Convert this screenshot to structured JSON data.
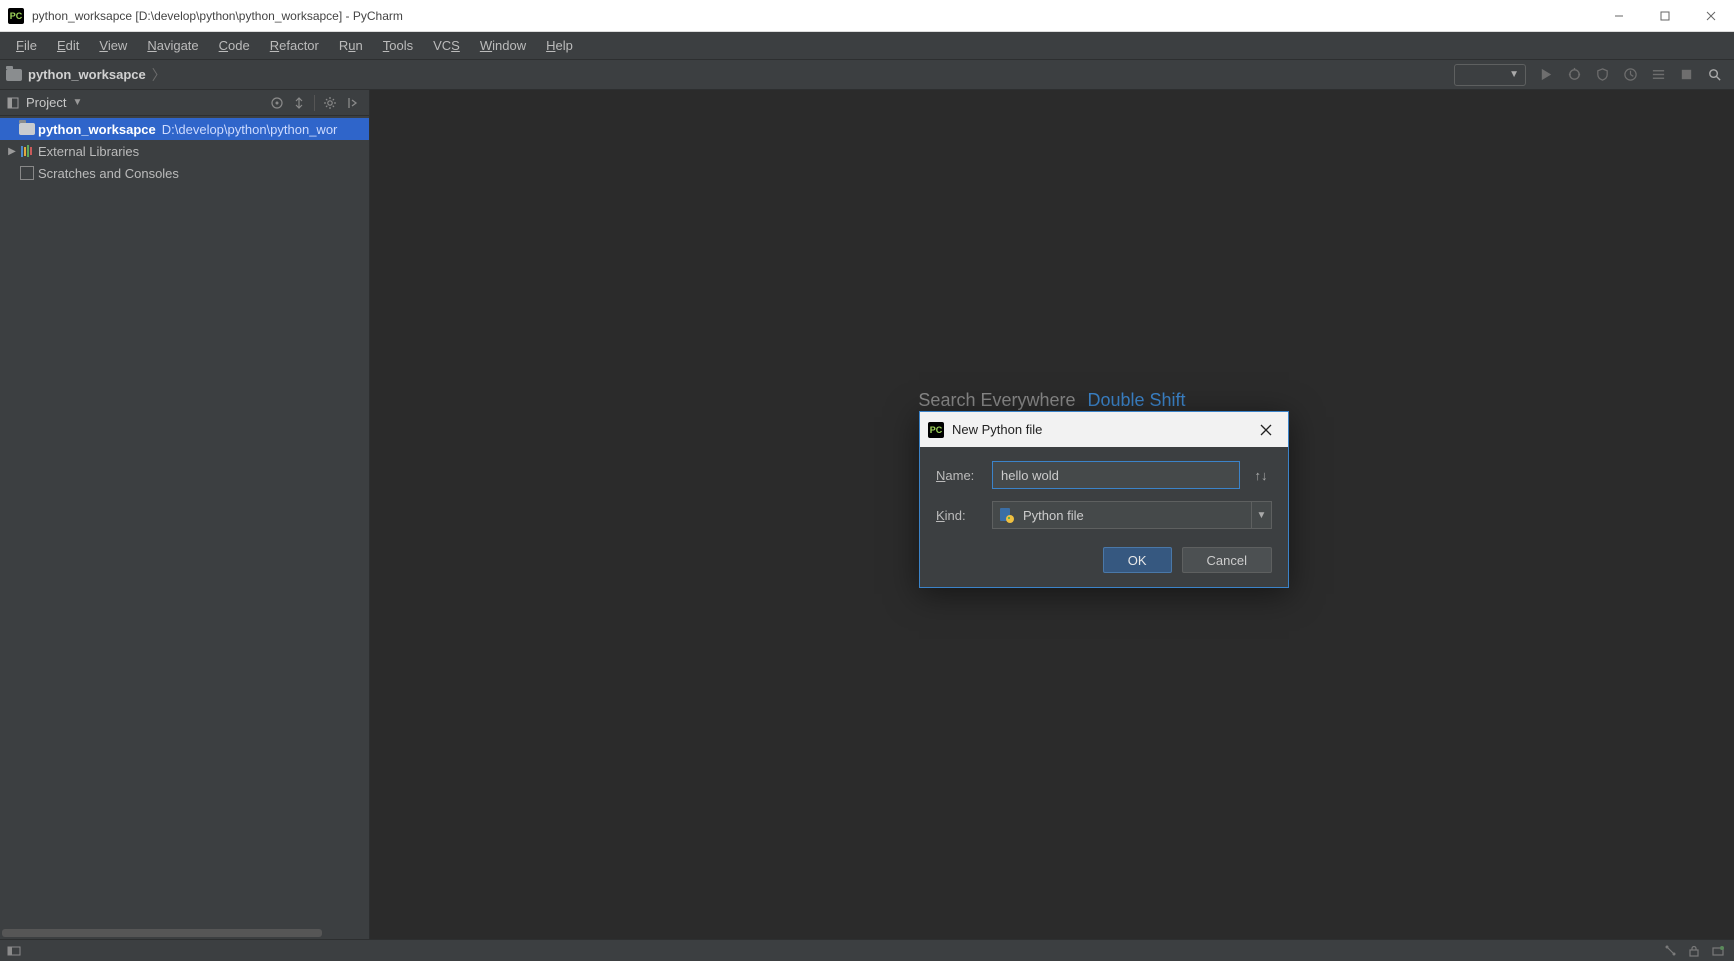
{
  "os_title": "python_worksapce [D:\\develop\\python\\python_worksapce] - PyCharm",
  "menu": [
    "File",
    "Edit",
    "View",
    "Navigate",
    "Code",
    "Refactor",
    "Run",
    "Tools",
    "VCS",
    "Window",
    "Help"
  ],
  "breadcrumb": {
    "label": "python_worksapce"
  },
  "project_panel": {
    "title": "Project"
  },
  "tree": {
    "workspace_name": "python_worksapce",
    "workspace_path": "D:\\develop\\python\\python_wor",
    "external_libs": "External Libraries",
    "scratches": "Scratches and Consoles"
  },
  "welcome": {
    "search_label": "Search Everywhere",
    "search_shortcut": "Double Shift"
  },
  "dialog": {
    "title": "New Python file",
    "name_label": "Name:",
    "name_value": "hello wold",
    "kind_label": "Kind:",
    "kind_value": "Python file",
    "ok": "OK",
    "cancel": "Cancel"
  }
}
